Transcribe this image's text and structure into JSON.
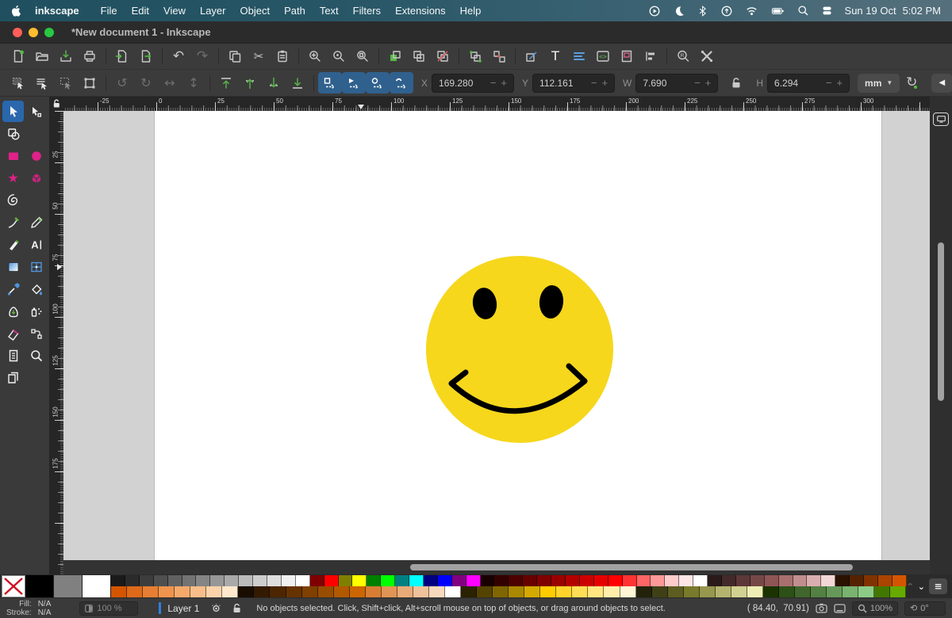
{
  "menubar": {
    "app_name": "inkscape",
    "items": [
      "File",
      "Edit",
      "View",
      "Layer",
      "Object",
      "Path",
      "Text",
      "Filters",
      "Extensions",
      "Help"
    ],
    "status_icons": [
      "record-icon",
      "moon-icon",
      "bluetooth-icon",
      "shortcuts-icon",
      "wifi-icon",
      "battery-icon",
      "search-icon",
      "control-center-icon"
    ],
    "date": "Sun 19 Oct",
    "time": "5:02 PM"
  },
  "titlebar": {
    "title": "*New document 1 - Inkscape",
    "traffic_lights": [
      "#ff5f57",
      "#febc2e",
      "#28c840"
    ]
  },
  "toolbar_main": {
    "icons": [
      "new-document",
      "open-document",
      "save-document",
      "print",
      "sep",
      "import",
      "export",
      "sep",
      "undo",
      "redo",
      "sep",
      "copy",
      "cut",
      "paste",
      "sep",
      "zoom-selection",
      "zoom-drawing",
      "zoom-page",
      "sep",
      "duplicate",
      "create-clone",
      "unlink-clone",
      "sep",
      "group-objects",
      "ungroup-objects",
      "sep",
      "fill-stroke-dialog",
      "text-dialog",
      "align-text",
      "xml-editor",
      "document-properties",
      "align-distribute",
      "sep",
      "find-replace",
      "preferences"
    ]
  },
  "toolbar_control": {
    "groups": [
      [
        "select-all",
        "select-all-layers",
        "deselect",
        "selection-frame"
      ],
      [
        "rotate-ccw",
        "rotate-cw",
        "flip-horizontal",
        "flip-vertical"
      ],
      [
        "raise-to-top",
        "raise",
        "lower",
        "lower-to-bottom"
      ],
      [
        "move-pattern",
        "move-gradient",
        "move-clip",
        "move-stroke"
      ]
    ],
    "fields": [
      {
        "label": "X",
        "value": "169.280"
      },
      {
        "label": "Y",
        "value": "112.161"
      },
      {
        "label": "W",
        "value": "7.690"
      },
      {
        "label": "H",
        "value": "6.294"
      }
    ],
    "minus": "−",
    "plus": "+",
    "unit": "mm"
  },
  "toolbox": {
    "tools": [
      "select",
      "node",
      "shape-builder",
      "",
      "rect",
      "ellipse",
      "star",
      "box3d",
      "spiral",
      "",
      "pen",
      "pencil",
      "calligraphy",
      "text",
      "gradient",
      "mesh",
      "dropper",
      "bucket",
      "tweak",
      "spray",
      "eraser",
      "connector",
      "measure",
      "zoom",
      "pages",
      ""
    ]
  },
  "rulers": {
    "horizontal": [
      "-25",
      "0",
      "25",
      "50",
      "75",
      "100",
      "125",
      "150",
      "175",
      "200",
      "225",
      "250",
      "275",
      "300"
    ],
    "vertical": [
      "25",
      "50",
      "75",
      "100",
      "125",
      "150",
      "175"
    ]
  },
  "canvas": {
    "face_color": "#f6d71c",
    "feature_color": "#000000",
    "page_color": "#ffffff"
  },
  "palette": {
    "special": [
      "none",
      "#000000",
      "#808080",
      "#ffffff"
    ],
    "row1": [
      "#1a1a1a",
      "#2b2b2b",
      "#3d3d3d",
      "#4f4f4f",
      "#616161",
      "#737373",
      "#858585",
      "#979797",
      "#a9a9a9",
      "#bbbbbb",
      "#cdcdcd",
      "#dfdfdf",
      "#f1f1f1",
      "#ffffff",
      "#800000",
      "#ff0000",
      "#808000",
      "#ffff00",
      "#008000",
      "#00ff00",
      "#008080",
      "#00ffff",
      "#000080",
      "#0000ff",
      "#800080",
      "#ff00ff",
      "#190000",
      "#330000",
      "#4c0000",
      "#660000",
      "#7f0000",
      "#990000",
      "#b20000",
      "#cc0000",
      "#e50000",
      "#ff0000",
      "#ff3333",
      "#ff6666",
      "#ff9999",
      "#ffcccc",
      "#ffe5e5",
      "#ffffff",
      "#2b1a1a",
      "#442929",
      "#5d3838",
      "#764747",
      "#8f5656",
      "#a86f6f",
      "#c18e8e",
      "#daaeae",
      "#f3d6d6",
      "#2b1100",
      "#552200",
      "#803300",
      "#aa4400",
      "#d45500"
    ],
    "row2": [
      "#d45500",
      "#dd6a1a",
      "#e67f33",
      "#ef944d",
      "#f4a96b",
      "#f8be8a",
      "#fbd3aa",
      "#ffe8cb",
      "#190d00",
      "#331a00",
      "#4c2600",
      "#663300",
      "#7f4000",
      "#994d00",
      "#b25900",
      "#cc6600",
      "#d97d33",
      "#e09455",
      "#e8ab78",
      "#efc29b",
      "#f7dabe",
      "#ffffff",
      "#2b2200",
      "#554400",
      "#806600",
      "#aa8800",
      "#d4aa00",
      "#ffcc00",
      "#ffd42a",
      "#ffdd55",
      "#ffe680",
      "#ffeeaa",
      "#fff6d5",
      "#23230b",
      "#404016",
      "#5d5d21",
      "#7a7a2c",
      "#97974e",
      "#b4b470",
      "#d1d192",
      "#eeeeb4",
      "#1a3300",
      "#2d5016",
      "#40662d",
      "#538043",
      "#669959",
      "#79b370",
      "#8ccc86",
      "#447700",
      "#66aa00"
    ]
  },
  "statusbar": {
    "fill_label": "Fill:",
    "fill_value": "N/A",
    "stroke_label": "Stroke:",
    "stroke_value": "N/A",
    "opacity": "100 %",
    "layer_name": "Layer 1",
    "message": "No objects selected. Click, Shift+click, Alt+scroll mouse on top of objects, or drag around objects to select.",
    "coords": "( 84.40,  70.91)",
    "zoom": "100%",
    "rotation": "0°"
  }
}
